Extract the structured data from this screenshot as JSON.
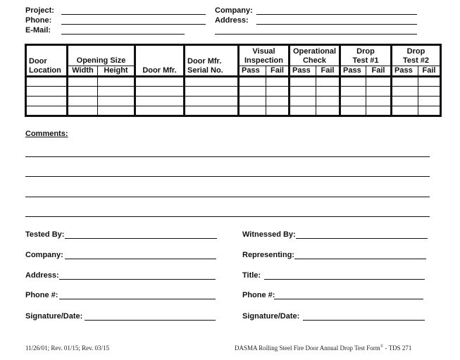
{
  "header": {
    "project_label": "Project:",
    "phone_label": "Phone:",
    "email_label": "E-Mail:",
    "company_label": "Company:",
    "address_label": "Address:"
  },
  "table": {
    "headers": {
      "door_location": [
        "Door",
        "Location"
      ],
      "opening_size": "Opening Size",
      "width": "Width",
      "height": "Height",
      "door_mfr": "Door Mfr.",
      "serial": [
        "Door Mfr.",
        "Serial No."
      ],
      "visual": [
        "Visual",
        "Inspection"
      ],
      "operational": [
        "Operational",
        "Check"
      ],
      "drop1": [
        "Drop",
        "Test #1"
      ],
      "drop2": [
        "Drop",
        "Test #2"
      ],
      "pass": "Pass",
      "fail": "Fail"
    },
    "row_count": 4
  },
  "comments": {
    "label": "Comments:",
    "line_count": 4
  },
  "signoff": {
    "left": [
      "Tested By:",
      "Company:",
      "Address:",
      "Phone #:",
      "Signature/Date:"
    ],
    "right": [
      "Witnessed By:",
      "Representing:",
      "Title:",
      "Phone #:",
      "Signature/Date:"
    ]
  },
  "footer": {
    "revision": "11/26/01; Rev. 01/15; Rev. 03/15",
    "form_title": "DASMA Rolling Steel Fire Door Annual Drop Test Form",
    "copyright": "©",
    "form_code": " - TDS 271"
  }
}
